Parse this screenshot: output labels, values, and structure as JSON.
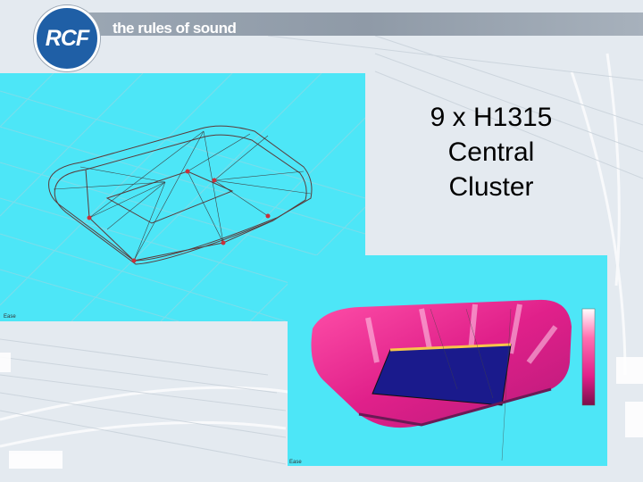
{
  "brand": {
    "logo_text": "RCF",
    "tagline": "the rules of sound"
  },
  "slide": {
    "title_line1": "9 x H1315",
    "title_line2": "Central",
    "title_line3": "Cluster"
  },
  "colors": {
    "panel_background": "#4de6f7",
    "logo_blue": "#1f5fa6",
    "heatmap_field": "#1a1a8c",
    "heatmap_hot": "#e0208a"
  }
}
